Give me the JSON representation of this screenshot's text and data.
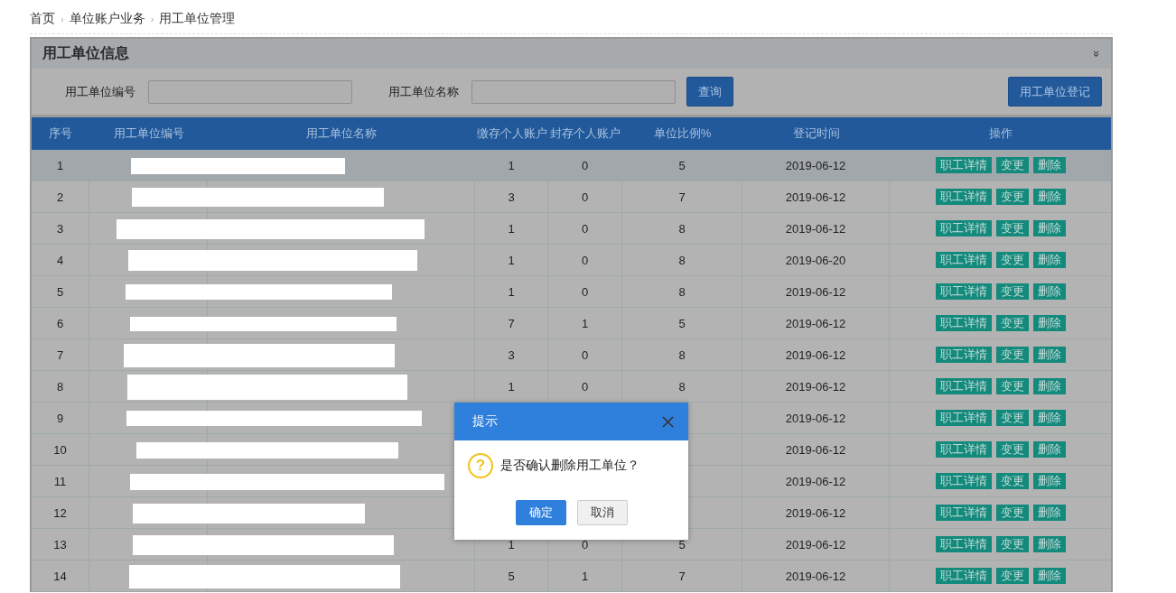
{
  "breadcrumb": [
    "首页",
    "单位账户业务",
    "用工单位管理"
  ],
  "breadcrumb_separator": "›",
  "panel": {
    "title": "用工单位信息",
    "collapse_icon": "»"
  },
  "filters": [
    {
      "label": "用工单位编号"
    },
    {
      "label": "用工单位名称"
    }
  ],
  "query_button": "查询",
  "register_button": "用工单位登记",
  "table": {
    "columns": [
      "序号",
      "用工单位编号",
      "用工单位名称",
      "缴存个人账户",
      "封存个人账户",
      "单位比例%",
      "登记时间",
      "操作"
    ],
    "rows": [
      {
        "no": "1",
        "paid": "1",
        "sealed": "0",
        "ratio": "5",
        "date": "2019-06-12",
        "selected": true,
        "actions": [
          "职工详情",
          "变更",
          "删除"
        ]
      },
      {
        "no": "2",
        "paid": "3",
        "sealed": "0",
        "ratio": "7",
        "date": "2019-06-12",
        "selected": false,
        "actions": [
          "职工详情",
          "变更",
          "删除"
        ]
      },
      {
        "no": "3",
        "paid": "1",
        "sealed": "0",
        "ratio": "8",
        "date": "2019-06-12",
        "selected": false,
        "actions": [
          "职工详情",
          "变更",
          "删除"
        ]
      },
      {
        "no": "4",
        "paid": "1",
        "sealed": "0",
        "ratio": "8",
        "date": "2019-06-20",
        "selected": false,
        "actions": [
          "职工详情",
          "变更",
          "删除"
        ]
      },
      {
        "no": "5",
        "paid": "1",
        "sealed": "0",
        "ratio": "8",
        "date": "2019-06-12",
        "selected": false,
        "actions": [
          "职工详情",
          "变更",
          "删除"
        ]
      },
      {
        "no": "6",
        "paid": "7",
        "sealed": "1",
        "ratio": "5",
        "date": "2019-06-12",
        "selected": false,
        "actions": [
          "职工详情",
          "变更",
          "删除"
        ]
      },
      {
        "no": "7",
        "paid": "3",
        "sealed": "0",
        "ratio": "8",
        "date": "2019-06-12",
        "selected": false,
        "actions": [
          "职工详情",
          "变更",
          "删除"
        ]
      },
      {
        "no": "8",
        "paid": "1",
        "sealed": "0",
        "ratio": "8",
        "date": "2019-06-12",
        "selected": false,
        "actions": [
          "职工详情",
          "变更",
          "删除"
        ]
      },
      {
        "no": "9",
        "date": "2019-06-12",
        "selected": false,
        "actions": [
          "职工详情",
          "变更",
          "删除"
        ]
      },
      {
        "no": "10",
        "date": "2019-06-12",
        "selected": false,
        "actions": [
          "职工详情",
          "变更",
          "删除"
        ]
      },
      {
        "no": "11",
        "date": "2019-06-12",
        "selected": false,
        "actions": [
          "职工详情",
          "变更",
          "删除"
        ]
      },
      {
        "no": "12",
        "date": "2019-06-12",
        "selected": false,
        "actions": [
          "职工详情",
          "变更",
          "删除"
        ]
      },
      {
        "no": "13",
        "paid": "1",
        "sealed": "0",
        "ratio": "5",
        "date": "2019-06-12",
        "selected": false,
        "actions": [
          "职工详情",
          "变更",
          "删除"
        ]
      },
      {
        "no": "14",
        "paid": "5",
        "sealed": "1",
        "ratio": "7",
        "date": "2019-06-12",
        "selected": false,
        "actions": [
          "职工详情",
          "变更",
          "删除"
        ]
      }
    ]
  },
  "dialog": {
    "title": "提示",
    "message": "是否确认删除用工单位？",
    "icon_text": "?",
    "buttons": [
      {
        "label": "确定",
        "kind": "primary"
      },
      {
        "label": "取消",
        "kind": "secondary"
      }
    ]
  }
}
